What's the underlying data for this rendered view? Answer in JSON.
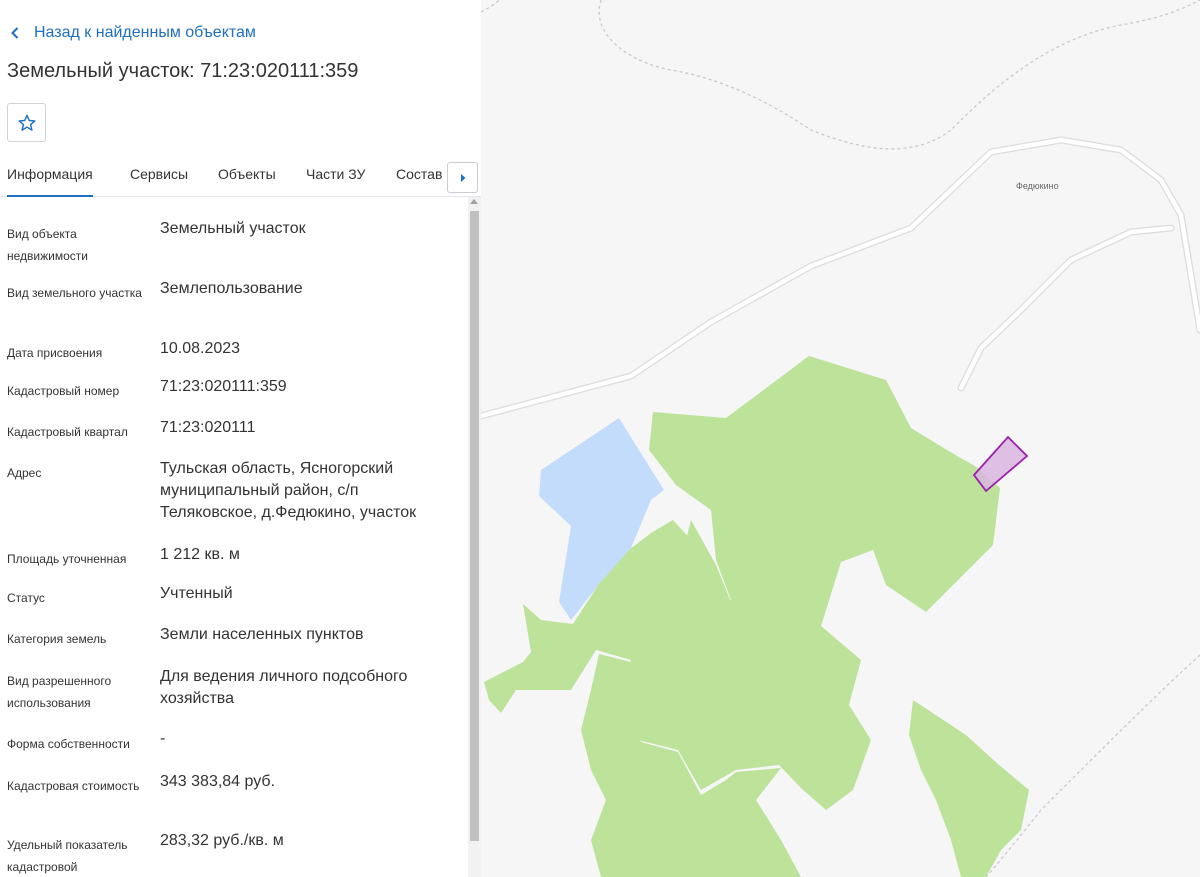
{
  "back_link": "Назад к найденным объектам",
  "title": "Земельный участок: 71:23:020111:359",
  "tabs": [
    "Информация",
    "Сервисы",
    "Объекты",
    "Части ЗУ",
    "Состав"
  ],
  "fields": [
    {
      "label": "Вид объекта недвижимости",
      "value": "Земельный участок"
    },
    {
      "label": "Вид земельного участка",
      "value": "Землепользование"
    },
    {
      "label": "Дата присвоения",
      "value": "10.08.2023"
    },
    {
      "label": "Кадастровый номер",
      "value": "71:23:020111:359"
    },
    {
      "label": "Кадастровый квартал",
      "value": "71:23:020111"
    },
    {
      "label": "Адрес",
      "value": "Тульская область, Ясногорский муниципальный район, с/п Теляковское, д.Федюкино, участок"
    },
    {
      "label": "Площадь уточненная",
      "value": "1 212 кв. м"
    },
    {
      "label": "Статус",
      "value": "Учтенный"
    },
    {
      "label": "Категория земель",
      "value": "Земли населенных пунктов"
    },
    {
      "label": "Вид разрешенного использования",
      "value": "Для ведения личного подсобного хозяйства"
    },
    {
      "label": "Форма собственности",
      "value": "-"
    },
    {
      "label": "Кадастровая стоимость",
      "value": "343 383,84 руб."
    },
    {
      "label": "Удельный показатель кадастровой",
      "value": "283,32 руб./кв. м"
    }
  ],
  "map": {
    "place_label": "Федюкино",
    "colors": {
      "forest": "#bde29a",
      "water": "#c3dcfb",
      "road_casing": "#dcdcdc",
      "road_fill": "#ffffff",
      "boundary": "#c9c9cc",
      "parcel_stroke": "#9b1fa8",
      "parcel_fill": "#d9b6e2"
    }
  },
  "colors": {
    "accent": "#1f6fc2",
    "text": "#333333"
  }
}
